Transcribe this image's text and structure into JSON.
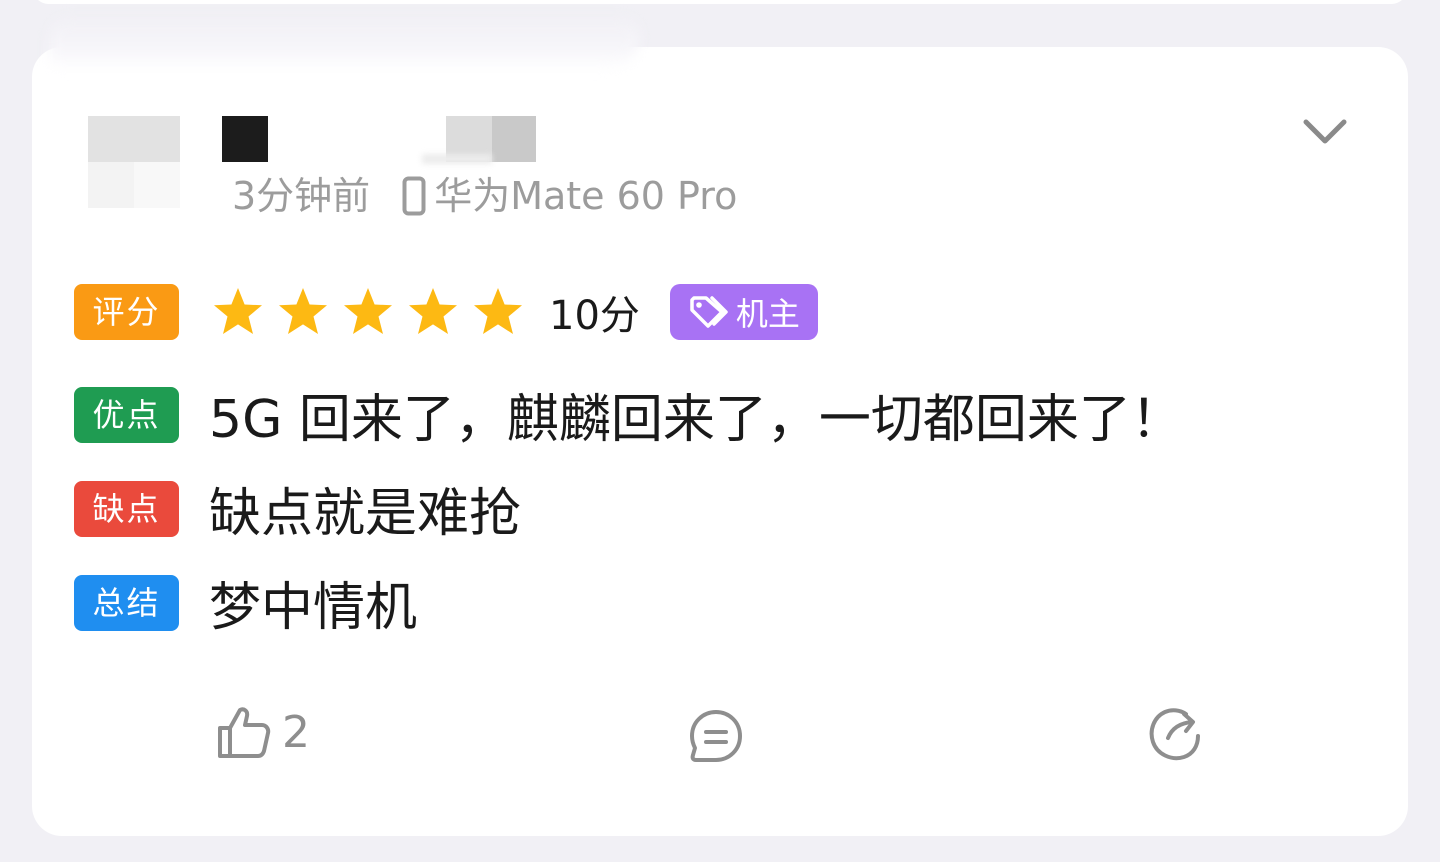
{
  "review": {
    "time_ago": "3分钟前",
    "device": "华为Mate 60 Pro",
    "rating": {
      "label": "评分",
      "stars": 5,
      "max_stars": 5,
      "score_text": "10分",
      "owner_badge": "机主"
    },
    "pros": {
      "label": "优点",
      "text": "5G 回来了，麒麟回来了，一切都回来了！"
    },
    "cons": {
      "label": "缺点",
      "text": "缺点就是难抢"
    },
    "summary": {
      "label": "总结",
      "text": "梦中情机"
    },
    "likes": "2"
  },
  "icons": {
    "expand": "chevron-down-icon",
    "device": "phone-icon",
    "star": "star-icon",
    "owner": "tag-icon",
    "like": "thumbs-up-icon",
    "comment": "comment-icon",
    "share": "share-icon"
  },
  "colors": {
    "rating_tag": "#fa9a14",
    "pros_tag": "#1f9c52",
    "cons_tag": "#ea4a3c",
    "summary_tag": "#1f8ef0",
    "owner_badge": "#a872f4",
    "star": "#fdb913"
  }
}
